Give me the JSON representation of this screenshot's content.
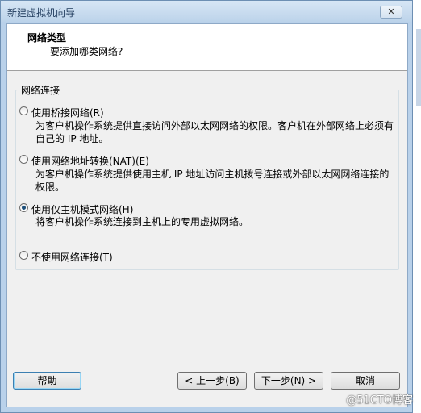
{
  "window": {
    "title": "新建虚拟机向导",
    "close_glyph": "✕"
  },
  "header": {
    "title": "网络类型",
    "subtitle": "要添加哪类网络?"
  },
  "group": {
    "label": "网络连接"
  },
  "options": [
    {
      "label": "使用桥接网络(R)",
      "description": "为客户机操作系统提供直接访问外部以太网网络的权限。客户机在外部网络上必须有自己的 IP 地址。",
      "selected": false
    },
    {
      "label": "使用网络地址转换(NAT)(E)",
      "description": "为客户机操作系统提供使用主机 IP 地址访问主机拨号连接或外部以太网网络连接的权限。",
      "selected": false
    },
    {
      "label": "使用仅主机模式网络(H)",
      "description": "将客户机操作系统连接到主机上的专用虚拟网络。",
      "selected": true
    },
    {
      "label": "不使用网络连接(T)",
      "description": "",
      "selected": false
    }
  ],
  "buttons": {
    "help": "帮助",
    "back": "< 上一步(B)",
    "next": "下一步(N) >",
    "cancel": "取消"
  },
  "watermark": "@51CTO博客"
}
